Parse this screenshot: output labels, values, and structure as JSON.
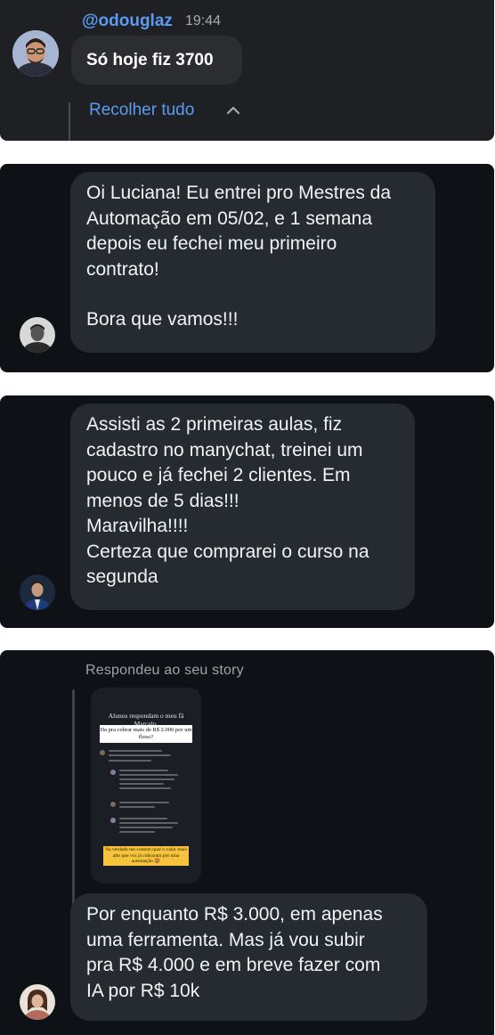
{
  "card1": {
    "username": "@odouglaz",
    "time": "19:44",
    "message": "Só hoje fiz 3700",
    "collapse_label": "Recolher tudo"
  },
  "card2": {
    "lines_a": [
      "Oi Luciana! Eu entrei pro Mestres da",
      "Automação em 05/02, e 1 semana",
      "depois eu fechei meu primeiro",
      "contrato!"
    ],
    "line_b": "Bora que vamos!!!"
  },
  "card3": {
    "lines": [
      "Assisti as 2 primeiras aulas, fiz",
      "cadastro no manychat, treinei um",
      "pouco e já fechei 2 clientes. Em",
      "menos de 5 dias!!!",
      "Maravilha!!!!",
      "Certeza que comprarei o curso na",
      "segunda"
    ]
  },
  "card4": {
    "reply_label": "Respondeu ao seu story",
    "story": {
      "title": "Alunos respondam o meu fã Marcelo.",
      "question": "Da pra cobrar mais de R$ 2.000 por um fluxo?",
      "highlight": "Na verdade me contem qual o valor mais alto que vcs já cobraram por uma automação 🥵"
    },
    "lines": [
      "Por enquanto R$ 3.000, em apenas",
      "uma ferramenta. Mas já vou subir",
      "pra R$ 4.000 e em breve fazer com",
      "IA por R$ 10k"
    ]
  },
  "colors": {
    "background": "#0e1217",
    "bubble": "#262a31",
    "link_blue": "#5b9bf0",
    "header_card": "#1f2023"
  }
}
